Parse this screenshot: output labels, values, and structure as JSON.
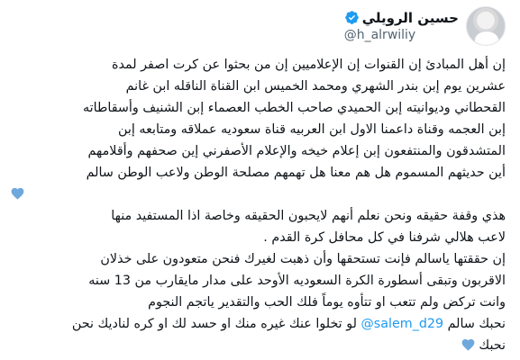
{
  "author": {
    "display_name": "حسين الرويلي",
    "handle": "@h_alrwiliy"
  },
  "colors": {
    "verified": "#1d9bf0",
    "heart": "#6fa8dc",
    "mention": "#1d9bf0",
    "text": "#0f1419",
    "secondary": "#536471"
  },
  "icons": {
    "verified": "verified-badge-icon",
    "heart": "blue-heart-icon"
  },
  "tweet": {
    "lines": [
      "إن أهل المبادئ إن القنوات إن الإعلاميين إن من بحثوا عن كرت اصفر لمدة",
      "عشرين يوم إبن بندر الشهري ومحمد الخميس ابن القناة الناقله ابن غانم",
      "القحطاني وديوانيته إبن الحميدي صاحب الخطب العصماء إبن الشنيف وأسقاطاته",
      "إبن العجمه وقناة داعمنا الاول ابن العربيه قناة سعوديه عملاقه ومتابعه إبن",
      "المتشدقون والمنتفعون إبن إعلام خيخه والإعلام الأصفرني إين صحفهم وأقلامهم",
      "أين حديثهم المسموم هل هم معنا هل تهمهم مصلحة الوطن ولاعب الوطن سالم",
      "",
      "هذي وقفة حقيقه ونحن نعلم أنهم لايحبون الحقيقه وخاصة اذا المستفيد منها",
      "لاعب هلالي شرفنا في كل محافل كرة القدم .",
      "إن حققتها ياسالم فإنت تستحقها وأن ذهبت لغيرك فنحن متعودون على خذلان",
      "الاقربون وتبقى أسطورة الكرة السعوديه الأوحد على مدار مايقارب من 13 سنه",
      "وانت تركض ولم تتعب او تتأوه يوماً فلك الحب والتقدير ياتجم النجوم"
    ],
    "last_prefix": "نحبك سالم",
    "mention": "@salem_d29",
    "last_suffix": "لو تخلوا عنك غيره منك او حسد لك او كره لناديك نحن",
    "last_line": "نحبك"
  }
}
